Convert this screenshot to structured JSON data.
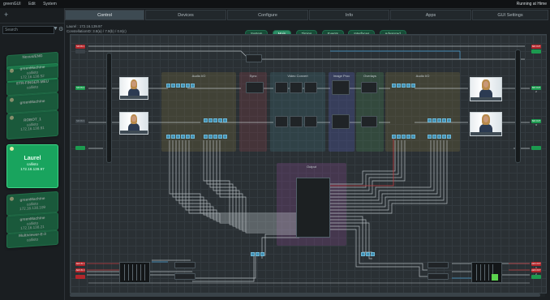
{
  "menu": [
    "greenGUI",
    "Edit",
    "System"
  ],
  "status_text": "Running at Hime",
  "sidebar": {
    "search_placeholder": "Search",
    "devices": [
      {
        "name": "Nexus/ENG",
        "sub": "",
        "addr": ""
      },
      {
        "name": "greenMachine",
        "sub": "callisto",
        "addr": "172.16.138.52"
      },
      {
        "name": "ETR-FINGER-MEU",
        "sub": "callisto",
        "addr": ""
      },
      {
        "name": "greenMachine",
        "sub": "",
        "addr": ""
      },
      {
        "name": "ROBOT_1",
        "sub": "callisto",
        "addr": "172.16.138.91"
      },
      {
        "name": "Laurel",
        "sub": "callisto",
        "addr": "172.16.139.97"
      },
      {
        "name": "greenMachine",
        "sub": "callisto",
        "addr": "172.16.138.109"
      },
      {
        "name": "greenMachine",
        "sub": "callisto",
        "addr": "172.16.138.21"
      },
      {
        "name": "Multiviewer-E-3",
        "sub": "callisto",
        "addr": ""
      }
    ]
  },
  "tabs": [
    "Control",
    "Devices",
    "Configure",
    "Info",
    "Apps",
    "GUI Settings"
  ],
  "active_tab": "Control",
  "info_lines": [
    "Laurel : 172.16.139.97",
    "ConstellationID: 3.8(a) / 7.9(b) / 0.8(c)"
  ],
  "subtabs": [
    "System",
    "Main",
    "Timing",
    "Events",
    "Interfaces",
    "Advanced"
  ],
  "active_subtab": "Main",
  "groups": [
    "Audio I/O",
    "Sync",
    "Video Convert",
    "Image Proc",
    "Overlays",
    "Audio I/O",
    "Output"
  ],
  "ports_left": [
    "SDI IN 1",
    "SDI IN 2",
    "SDI IN 3",
    "AES IN 1",
    "AES IN 2"
  ],
  "ports_right": [
    "SDI OUT 1",
    "SDI OUT 2",
    "SDI OUT 3",
    "AES OUT 1",
    "AES OUT 2"
  ],
  "colors": {
    "accent": "#2c8e66",
    "card": "#1a8a52",
    "wire": "#c9d0d4",
    "wire_blue": "#4aa3d6",
    "wire_red": "#c23a3f",
    "port_red": "#b3262b",
    "port_green": "#1c9a4f"
  }
}
